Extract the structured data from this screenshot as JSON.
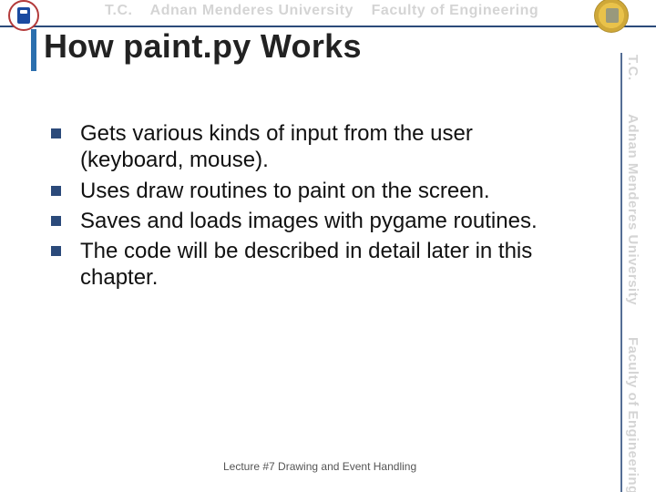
{
  "header": {
    "tc": "T.C.",
    "university": "Adnan Menderes University",
    "faculty": "Faculty of Engineering",
    "logo_left": "university-seal",
    "logo_right": "engineering-seal"
  },
  "title": "How paint.py Works",
  "bullets": [
    "Gets various kinds of input from the user (keyboard, mouse).",
    "Uses draw routines to paint on the screen.",
    "Saves and loads images with pygame routines.",
    "The code will be described in detail later in this chapter."
  ],
  "footer": "Lecture #7 Drawing and Event Handling",
  "colors": {
    "accent": "#2b4a7a",
    "title_bar": "#2b6fae",
    "bullet": "#2b4a7a"
  }
}
